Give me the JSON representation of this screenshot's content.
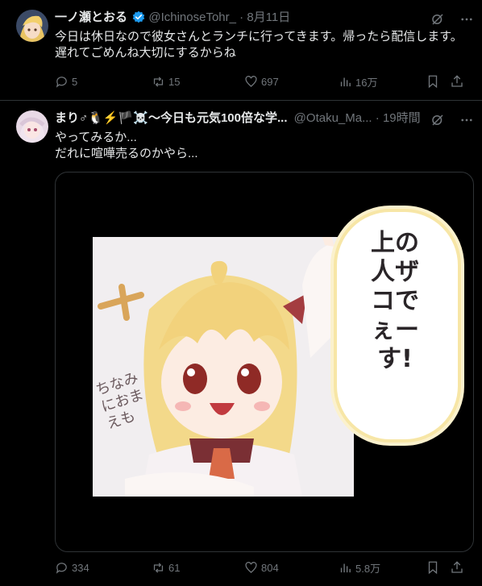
{
  "tweets": [
    {
      "display_name": "一ノ瀬とおる",
      "handle": "@IchinoseTohr_",
      "time": "8月11日",
      "lines": [
        "今日は休日なので彼女さんとランチに行ってきます。帰ったら配信します。",
        "遅れてごめんね大切にするからね"
      ],
      "reply_count": "5",
      "retweet_count": "15",
      "like_count": "697",
      "view_count": "16万"
    },
    {
      "display_name": "まり♂🐧⚡🏴☠️〜今日も元気100倍な学...",
      "handle": "@Otaku_Ma...",
      "time": "19時間",
      "lines": [
        "やってみるか...",
        "だれに喧嘩売るのかやら..."
      ],
      "sticker_bubble": "上の人ザコでぇーす!",
      "sticker_side": "ちなみにおまえも",
      "reply_count": "334",
      "retweet_count": "61",
      "like_count": "804",
      "view_count": "5.8万"
    }
  ],
  "colors": {
    "background": "#000000",
    "text": "#e7e9ea",
    "muted": "#71767b",
    "verified": "#1d9bf0",
    "divider": "#2f3336"
  }
}
